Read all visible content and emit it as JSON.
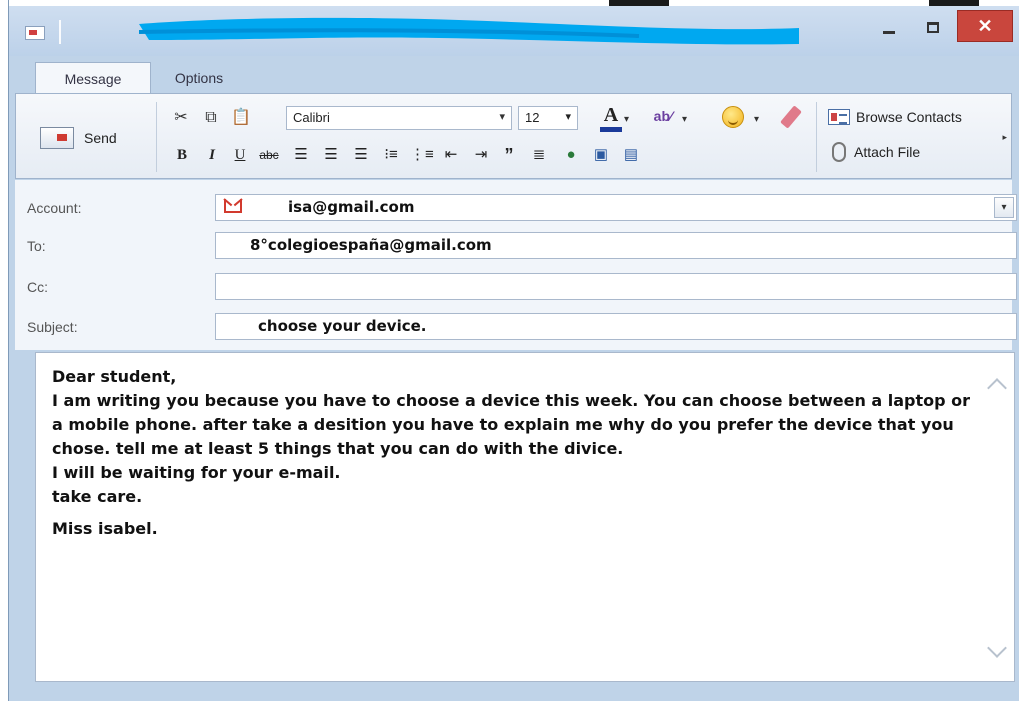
{
  "window": {
    "minimize_glyph": "",
    "maximize_glyph": "",
    "close_glyph": "✕"
  },
  "tabs": [
    {
      "label": "Message",
      "active": true
    },
    {
      "label": "Options",
      "active": false
    }
  ],
  "ribbon": {
    "send_label": "Send",
    "font_name": "Calibri",
    "font_size": "12",
    "bold": "B",
    "italic": "I",
    "underline": "U",
    "strike": "abc",
    "quote": "”",
    "browse_contacts_label": "Browse Contacts",
    "attach_file_label": "Attach File",
    "icons": [
      "cut-icon",
      "copy-icon",
      "paste-icon",
      "font-color-icon",
      "highlight-icon",
      "emoticon-icon",
      "eraser-icon",
      "align-left-icon",
      "align-center-icon",
      "align-right-icon",
      "bullets-icon",
      "numbering-icon",
      "outdent-icon",
      "indent-icon",
      "blockquote-icon",
      "line-spacing-icon",
      "link-icon",
      "image-icon",
      "picture-icon"
    ]
  },
  "fields": {
    "account_label": "Account:",
    "account_value": "isa@gmail.com",
    "to_label": "To:",
    "to_value": "8°colegioespaña@gmail.com",
    "cc_label": "Cc:",
    "cc_value": "",
    "subject_label": "Subject:",
    "subject_value": "choose your device."
  },
  "body": {
    "line1": "Dear student,",
    "line2": "I am writing you because you have to choose a device this week. You can choose between a laptop or a mobile phone. after take a desition you have to explain me why do you prefer the device that you chose. tell me at least 5 things that you can do with the divice.",
    "line3": "I will be waiting for your e-mail.",
    "line4": "take care.",
    "signature": "Miss isabel."
  },
  "colors": {
    "close_button": "#c9463d",
    "gmail_red": "#d23a2e",
    "scribble_blue": "#00a8f0",
    "font_color_bar": "#1a3a9a"
  }
}
